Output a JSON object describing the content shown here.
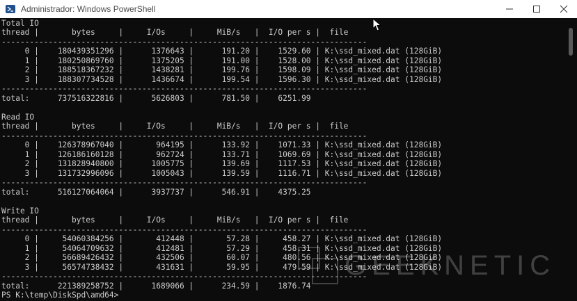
{
  "window": {
    "title": "Administrador: Windows PowerShell",
    "icon": "powershell-icon",
    "controls": [
      "minimize-icon",
      "maximize-icon",
      "close-icon"
    ]
  },
  "console": {
    "lines": [
      "Total IO",
      "thread |       bytes     |     I/Os     |     MiB/s   |  I/O per s |  file",
      "------------------------------------------------------------------------------",
      "     0 |    180439351296 |      1376643 |      191.20 |    1529.60 | K:\\ssd_mixed.dat (128GiB)",
      "     1 |    180250869760 |      1375205 |      191.00 |    1528.00 | K:\\ssd_mixed.dat (128GiB)",
      "     2 |    188518367232 |      1438281 |      199.76 |    1598.09 | K:\\ssd_mixed.dat (128GiB)",
      "     3 |    188307734528 |      1436674 |      199.54 |    1596.30 | K:\\ssd_mixed.dat (128GiB)",
      "------------------------------------------------------------------------------",
      "total:      737516322816 |      5626803 |      781.50 |    6251.99",
      "",
      "Read IO",
      "thread |       bytes     |     I/Os     |     MiB/s   |  I/O per s |  file",
      "------------------------------------------------------------------------------",
      "     0 |    126378967040 |       964195 |      133.92 |    1071.33 | K:\\ssd_mixed.dat (128GiB)",
      "     1 |    126186160128 |       962724 |      133.71 |    1069.69 | K:\\ssd_mixed.dat (128GiB)",
      "     2 |    131828940800 |      1005775 |      139.69 |    1117.53 | K:\\ssd_mixed.dat (128GiB)",
      "     3 |    131732996096 |      1005043 |      139.59 |    1116.71 | K:\\ssd_mixed.dat (128GiB)",
      "------------------------------------------------------------------------------",
      "total:      516127064064 |      3937737 |      546.91 |    4375.25",
      "",
      "Write IO",
      "thread |       bytes     |     I/Os     |     MiB/s   |  I/O per s |  file",
      "------------------------------------------------------------------------------",
      "     0 |     54060384256 |       412448 |       57.28 |     458.27 | K:\\ssd_mixed.dat (128GiB)",
      "     1 |     54064709632 |       412481 |       57.29 |     458.31 | K:\\ssd_mixed.dat (128GiB)",
      "     2 |     56689426432 |       432506 |       60.07 |     480.56 | K:\\ssd_mixed.dat (128GiB)",
      "     3 |     56574738432 |       431631 |       59.95 |     479.59 | K:\\ssd_mixed.dat (128GiB)",
      "------------------------------------------------------------------------------",
      "total:      221389258752 |      1689066 |      234.59 |    1876.74",
      "PS K:\\temp\\DiskSpd\\amd64>"
    ]
  },
  "watermark": {
    "text": "GEEKNETIC"
  },
  "colors": {
    "console_bg": "#0c0c0c",
    "console_fg": "#cccccc",
    "titlebar_bg": "#ffffff",
    "titlebar_fg": "#4a4a4a",
    "icon_blue": "#1f4f8f"
  }
}
